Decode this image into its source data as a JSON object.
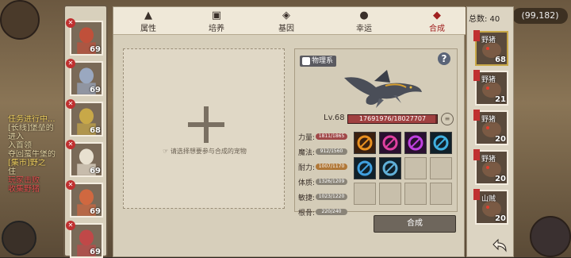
{
  "background": {
    "coord": "(99,182)",
    "log_lines": [
      {
        "text": "任务进行中...",
        "cls": "yel"
      },
      {
        "text": "[长线]堡垒的",
        "cls": ""
      },
      {
        "text": "进入",
        "cls": ""
      },
      {
        "text": "入首领",
        "cls": ""
      },
      {
        "text": "夺回蛮牛堡的",
        "cls": ""
      },
      {
        "text": "[集市]野之",
        "cls": "yel"
      },
      {
        "text": "住",
        "cls": ""
      },
      {
        "text": "玩家击败",
        "cls": "red"
      },
      {
        "text": "收集野猪",
        "cls": "red"
      }
    ]
  },
  "tabs": [
    {
      "icon": "▲",
      "label": "属性",
      "name": "tab-attributes"
    },
    {
      "icon": "▣",
      "label": "培养",
      "name": "tab-train"
    },
    {
      "icon": "◈",
      "label": "基因",
      "name": "tab-gene"
    },
    {
      "icon": "●",
      "label": "幸运",
      "name": "tab-luck"
    },
    {
      "icon": "◆",
      "label": "合成",
      "name": "tab-compose"
    }
  ],
  "left_pets": [
    {
      "level": "69",
      "color": "#c0503a"
    },
    {
      "level": "69",
      "color": "#9aa8c0"
    },
    {
      "level": "68",
      "color": "#c8a848"
    },
    {
      "level": "69",
      "color": "#e8e0d0"
    },
    {
      "level": "69",
      "color": "#d06840"
    },
    {
      "level": "69",
      "color": "#c04848"
    }
  ],
  "select_hint": "请选择想要参与合成的宠物",
  "detail": {
    "type_badge": "物理系",
    "level": "Lv.68",
    "hp_text": "17691976/18027707",
    "hp_fraction": 0.98,
    "stats": [
      {
        "key": "力量:",
        "value": "1811/1865",
        "cls": "red"
      },
      {
        "key": "魔法:",
        "value": "912/1560",
        "cls": ""
      },
      {
        "key": "耐力:",
        "value": "1007/1170",
        "cls": "orange"
      },
      {
        "key": "体质:",
        "value": "1326/1209",
        "cls": ""
      },
      {
        "key": "敏捷:",
        "value": "1023/1220",
        "cls": ""
      },
      {
        "key": "根骨:",
        "value": "220/240",
        "cls": ""
      }
    ],
    "skills": [
      {
        "color": "#e89020",
        "bg": "#3a2010"
      },
      {
        "color": "#e040a0",
        "bg": "#2a1030"
      },
      {
        "color": "#c040e0",
        "bg": "#2a1030"
      },
      {
        "color": "#40b0e0",
        "bg": "#10202a"
      },
      {
        "color": "#40a0e0",
        "bg": "#10202a"
      },
      {
        "color": "#60b0d8",
        "bg": "#10202a"
      }
    ]
  },
  "compose_label": "合成",
  "right": {
    "total": "总数: 40",
    "cards": [
      {
        "name": "野猪",
        "level": "68",
        "selected": true
      },
      {
        "name": "野猪",
        "level": "21",
        "selected": false
      },
      {
        "name": "野猪",
        "level": "20",
        "selected": false
      },
      {
        "name": "野猪",
        "level": "20",
        "selected": false
      },
      {
        "name": "山贼",
        "level": "20",
        "selected": false
      }
    ]
  }
}
